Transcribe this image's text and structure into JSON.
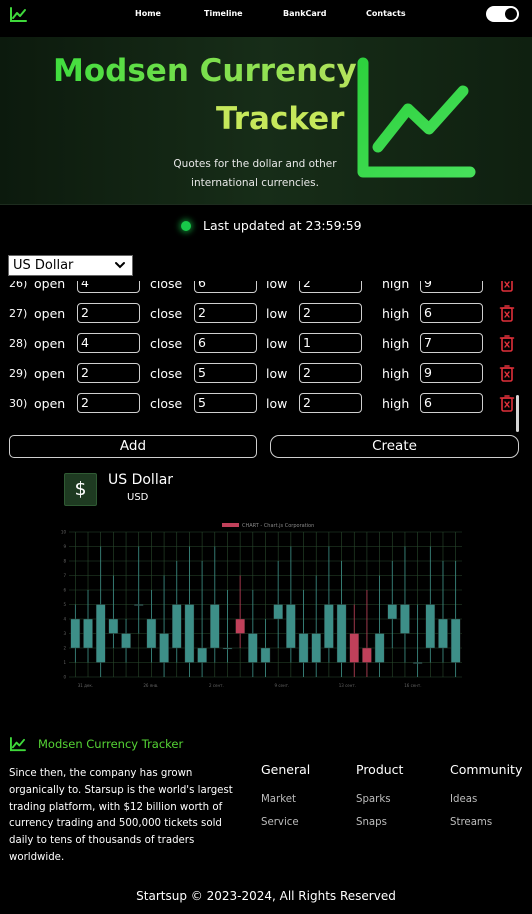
{
  "nav": {
    "links": [
      "Home",
      "Timeline",
      "BankCard",
      "Contacts"
    ]
  },
  "hero": {
    "title_line1": "Modsen Currency",
    "title_line2": "Tracker",
    "subtitle_line1": "Quotes for the dollar and other",
    "subtitle_line2": "international currencies."
  },
  "status": {
    "text": "Last updated at 23:59:59",
    "color": "#18c94a"
  },
  "selector": {
    "value": "US Dollar"
  },
  "form": {
    "labels": {
      "open": "open",
      "close": "close",
      "low": "low",
      "high": "high"
    },
    "rows": [
      {
        "num": "26)",
        "open": "4",
        "close": "6",
        "low": "2",
        "high": "9"
      },
      {
        "num": "27)",
        "open": "2",
        "close": "2",
        "low": "2",
        "high": "6"
      },
      {
        "num": "28)",
        "open": "4",
        "close": "6",
        "low": "1",
        "high": "7"
      },
      {
        "num": "29)",
        "open": "2",
        "close": "5",
        "low": "2",
        "high": "9"
      },
      {
        "num": "30)",
        "open": "2",
        "close": "5",
        "low": "2",
        "high": "6"
      }
    ],
    "add_label": "Add",
    "create_label": "Create"
  },
  "currency": {
    "symbol": "$",
    "name": "US Dollar",
    "code": "USD"
  },
  "chart_data": {
    "type": "candlestick",
    "legend": "CHART - Chart.js Corporation",
    "ylim": [
      0,
      10
    ],
    "y_ticks": [
      "0",
      "1",
      "2",
      "3",
      "4",
      "5",
      "6",
      "7",
      "8",
      "9",
      "10"
    ],
    "x_ticks": [
      "31 дек.",
      "26 янв.",
      "2 сент.",
      "9 сент.",
      "13 сент.",
      "16 сент."
    ],
    "up_color": "#3d8f88",
    "down_color": "#c0405a",
    "candles": [
      {
        "o": 2,
        "c": 4,
        "l": 1,
        "h": 5
      },
      {
        "o": 2,
        "c": 4,
        "l": 1,
        "h": 6
      },
      {
        "o": 1,
        "c": 5,
        "l": 0,
        "h": 9
      },
      {
        "o": 3,
        "c": 4,
        "l": 2,
        "h": 7
      },
      {
        "o": 2,
        "c": 3,
        "l": 1,
        "h": 4
      },
      {
        "o": 5,
        "c": 5,
        "l": 3,
        "h": 9
      },
      {
        "o": 2,
        "c": 4,
        "l": 1,
        "h": 6
      },
      {
        "o": 1,
        "c": 3,
        "l": 0,
        "h": 7
      },
      {
        "o": 2,
        "c": 5,
        "l": 1,
        "h": 8
      },
      {
        "o": 1,
        "c": 5,
        "l": 0,
        "h": 9
      },
      {
        "o": 1,
        "c": 2,
        "l": 0,
        "h": 8
      },
      {
        "o": 2,
        "c": 5,
        "l": 1,
        "h": 9
      },
      {
        "o": 2,
        "c": 2,
        "l": 1,
        "h": 6
      },
      {
        "o": 4,
        "c": 3,
        "l": 2,
        "h": 7
      },
      {
        "o": 1,
        "c": 3,
        "l": 0,
        "h": 6
      },
      {
        "o": 1,
        "c": 2,
        "l": 0,
        "h": 4
      },
      {
        "o": 4,
        "c": 5,
        "l": 2,
        "h": 8
      },
      {
        "o": 2,
        "c": 5,
        "l": 1,
        "h": 9
      },
      {
        "o": 1,
        "c": 3,
        "l": 0,
        "h": 6
      },
      {
        "o": 1,
        "c": 3,
        "l": 0,
        "h": 7
      },
      {
        "o": 2,
        "c": 5,
        "l": 1,
        "h": 9
      },
      {
        "o": 1,
        "c": 5,
        "l": 0,
        "h": 8
      },
      {
        "o": 3,
        "c": 1,
        "l": 0,
        "h": 5
      },
      {
        "o": 2,
        "c": 1,
        "l": 0,
        "h": 6
      },
      {
        "o": 1,
        "c": 3,
        "l": 0,
        "h": 7
      },
      {
        "o": 4,
        "c": 5,
        "l": 2,
        "h": 8
      },
      {
        "o": 3,
        "c": 5,
        "l": 1,
        "h": 9
      },
      {
        "o": 1,
        "c": 1,
        "l": 0,
        "h": 5
      },
      {
        "o": 2,
        "c": 5,
        "l": 1,
        "h": 9
      },
      {
        "o": 2,
        "c": 4,
        "l": 1,
        "h": 8
      },
      {
        "o": 1,
        "c": 4,
        "l": 0,
        "h": 8
      }
    ]
  },
  "footer": {
    "brand": "Modsen Currency Tracker",
    "text": "Since then, the company has grown organically to. Starsup is the world's largest trading platform, with $12 billion worth of currency trading and 500,000 tickets sold daily to tens of thousands of traders worldwide.",
    "columns": [
      {
        "heading": "General",
        "links": [
          "Market",
          "Service"
        ]
      },
      {
        "heading": "Product",
        "links": [
          "Sparks",
          "Snaps"
        ]
      },
      {
        "heading": "Community",
        "links": [
          "Ideas",
          "Streams"
        ]
      }
    ],
    "copyright": "Startsup © 2023-2024, All Rights Reserved"
  }
}
